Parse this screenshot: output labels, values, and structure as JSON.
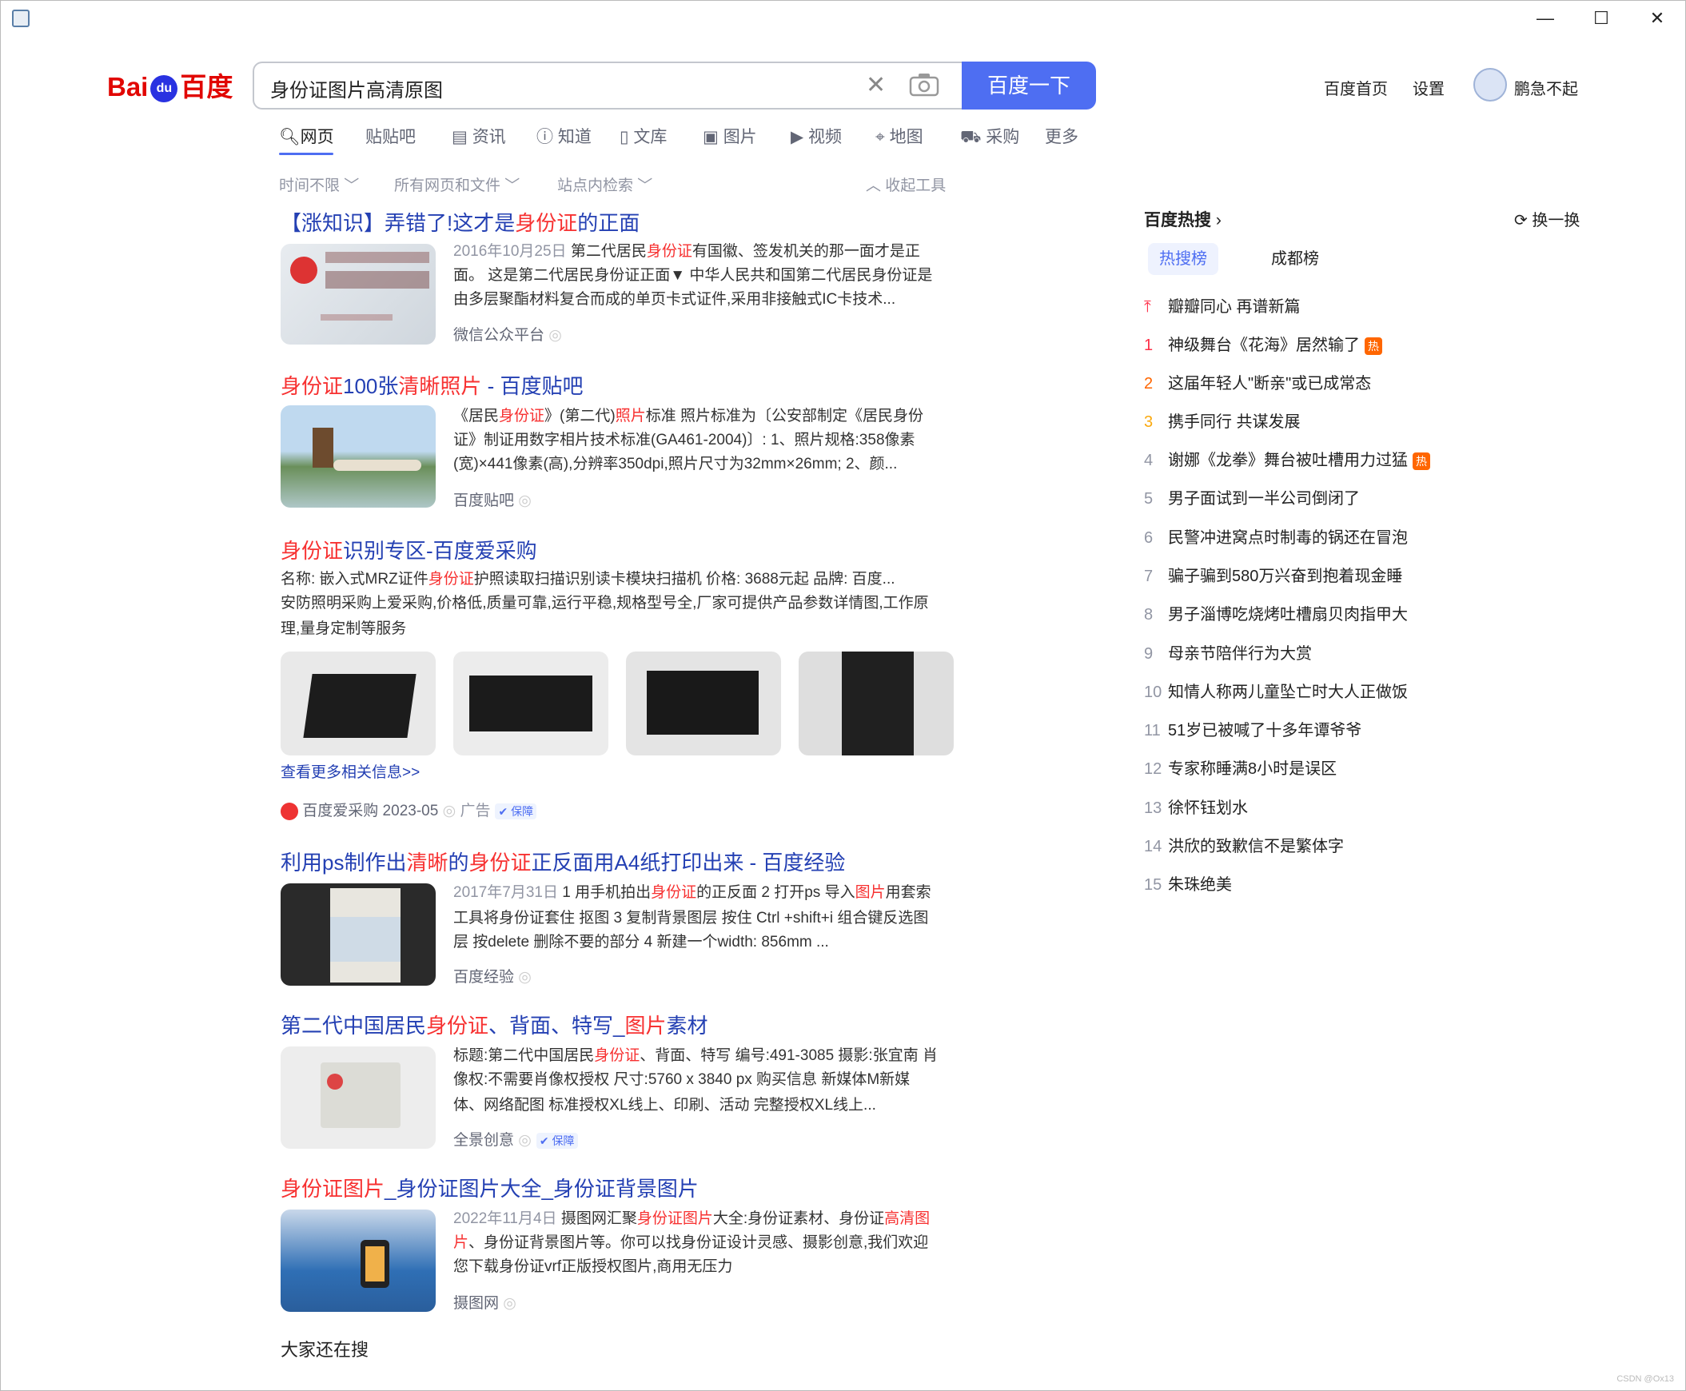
{
  "window": {
    "minimize": "—",
    "maximize": "☐",
    "close": "✕"
  },
  "logo": {
    "bai": "Bai",
    "paw": "du",
    "du": "百度"
  },
  "search": {
    "query": "身份证图片高清原图",
    "button": "百度一下"
  },
  "toplinks": {
    "home": "百度首页",
    "settings": "设置",
    "user": "鹏急不起"
  },
  "tabs": [
    "网页",
    "贴吧",
    "资讯",
    "知道",
    "文库",
    "图片",
    "视频",
    "地图",
    "采购",
    "更多"
  ],
  "filters": {
    "time": "时间不限",
    "scope": "所有网页和文件",
    "site": "站点内检索",
    "collapse": "收起工具"
  },
  "results": [
    {
      "title_a": "【涨知识】弄错了!这才是",
      "title_hl": "身份证",
      "title_b": "的正面",
      "line1_date": "2016年10月25日",
      "line1_a": " 第二代居民",
      "line1_hl": "身份证",
      "line1_b": "有国徽、签发机关的那一面才是正",
      "line2": "面。 这是第二代居民身份证正面▼ 中华人民共和国第二代居民身份证是",
      "line3": "由多层聚酯材料复合而成的单页卡式证件,采用非接触式IC卡技术...",
      "source": "微信公众平台"
    },
    {
      "title_hl": "身份证",
      "title_a": "100张",
      "title_hl2": "清晰照片",
      "title_b": " - 百度贴吧",
      "line1_a": "《居民",
      "line1_hl": "身份证",
      "line1_b": "》(第二代)",
      "line1_hl2": "照片",
      "line1_c": "标准 照片标准为〔公安部制定《居民身份",
      "line2": "证》制证用数字相片技术标准(GA461-2004)〕: 1、照片规格:358像素",
      "line3": "(宽)×441像素(高),分辨率350dpi,照片尺寸为32mm×26mm; 2、颜...",
      "source": "百度贴吧"
    },
    {
      "title_hl": "身份证",
      "title_a": "识别专区-百度爱采购",
      "line1_a": "名称: 嵌入式MRZ证件",
      "line1_hl": "身份证",
      "line1_b": "护照读取扫描识别读卡模块扫描机    价格: 3688元起    品牌: 百度...",
      "line2": "安防照明采购上爱采购,价格低,质量可靠,运行平稳,规格型号全,厂家可提供产品参数详情图,工作原",
      "line3": "理,量身定制等服务",
      "more": "查看更多相关信息>>",
      "source": "百度爱采购 2023-05",
      "ad": "广告",
      "guarantee": "保障"
    },
    {
      "title_a": "利用ps制作出",
      "title_hl": "清晰",
      "title_b": "的",
      "title_hl2": "身份证",
      "title_c": "正反面用A4纸打印出来 - 百度经验",
      "line1_date": "2017年7月31日",
      "line1_a": " 1 用手机拍出",
      "line1_hl": "身份证",
      "line1_b": "的正反面 2 打开ps 导入",
      "line1_hl2": "图片",
      "line1_c": "用套索",
      "line2": "工具将身份证套住 抠图 3 复制背景图层 按住 Ctrl +shift+i 组合键反选图",
      "line3": "层 按delete 删除不要的部分 4 新建一个width: 856mm ...",
      "source": "百度经验"
    },
    {
      "title_a": "第二代中国居民",
      "title_hl": "身份证",
      "title_b": "、背面、特写_",
      "title_hl2": "图片",
      "title_c": "素材",
      "line1_a": "标题:第二代中国居民",
      "line1_hl": "身份证",
      "line1_b": "、背面、特写 编号:491-3085 摄影:张宜南 肖",
      "line2": "像权:不需要肖像权授权 尺寸:5760 x 3840 px 购买信息 新媒体M新媒",
      "line3": "体、网络配图 标准授权XL线上、印刷、活动 完整授权XL线上...",
      "source": "全景创意",
      "guarantee": "保障"
    },
    {
      "title_hl": "身份证图片",
      "title_a": "_身份证图片大全_身份证背景图片",
      "line1_date": "2022年11月4日",
      "line1_a": " 摄图网汇聚",
      "line1_hl": "身份证图片",
      "line1_b": "大全:身份证素材、身份证",
      "line1_hl2": "高清图",
      "line2_hl": "片",
      "line2": "、身份证背景图片等。你可以找身份证设计灵感、摄影创意,我们欢迎",
      "line3": "您下载身份证vrf正版授权图片,商用无压力",
      "source": "摄图网"
    }
  ],
  "related": "大家还在搜",
  "hotsearch": {
    "title": "百度热搜",
    "change": "换一换",
    "tabs": [
      "热搜榜",
      "成都榜"
    ],
    "hot_badge": "热",
    "pinned": "瓣瓣同心 再谱新篇",
    "items": [
      {
        "n": "1",
        "t": "神级舞台《花海》居然输了"
      },
      {
        "n": "2",
        "t": "这届年轻人\"断亲\"或已成常态"
      },
      {
        "n": "3",
        "t": "携手同行 共谋发展"
      },
      {
        "n": "4",
        "t": "谢娜《龙拳》舞台被吐槽用力过猛"
      },
      {
        "n": "5",
        "t": "男子面试到一半公司倒闭了"
      },
      {
        "n": "6",
        "t": "民警冲进窝点时制毒的锅还在冒泡"
      },
      {
        "n": "7",
        "t": "骗子骗到580万兴奋到抱着现金睡"
      },
      {
        "n": "8",
        "t": "男子淄博吃烧烤吐槽扇贝肉指甲大"
      },
      {
        "n": "9",
        "t": "母亲节陪伴行为大赏"
      },
      {
        "n": "10",
        "t": "知情人称两儿童坠亡时大人正做饭"
      },
      {
        "n": "11",
        "t": "51岁已被喊了十多年谭爷爷"
      },
      {
        "n": "12",
        "t": "专家称睡满8小时是误区"
      },
      {
        "n": "13",
        "t": "徐怀钰划水"
      },
      {
        "n": "14",
        "t": "洪欣的致歉信不是繁体字"
      },
      {
        "n": "15",
        "t": "朱珠绝美"
      }
    ]
  },
  "watermark": "CSDN @Ox13"
}
